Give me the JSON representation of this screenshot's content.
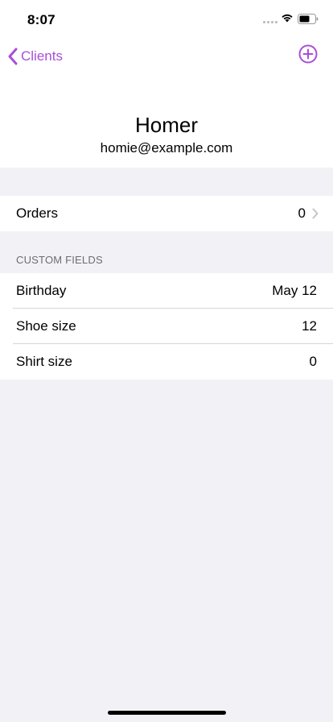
{
  "status_bar": {
    "time": "8:07"
  },
  "nav": {
    "back_label": "Clients"
  },
  "client": {
    "name": "Homer",
    "email": "homie@example.com"
  },
  "orders": {
    "label": "Orders",
    "count": "0"
  },
  "custom_fields": {
    "header": "CUSTOM FIELDS",
    "items": [
      {
        "label": "Birthday",
        "value": "May 12"
      },
      {
        "label": "Shoe size",
        "value": "12"
      },
      {
        "label": "Shirt size",
        "value": "0"
      }
    ]
  },
  "colors": {
    "accent": "#a94fd6",
    "background": "#f2f1f6"
  }
}
